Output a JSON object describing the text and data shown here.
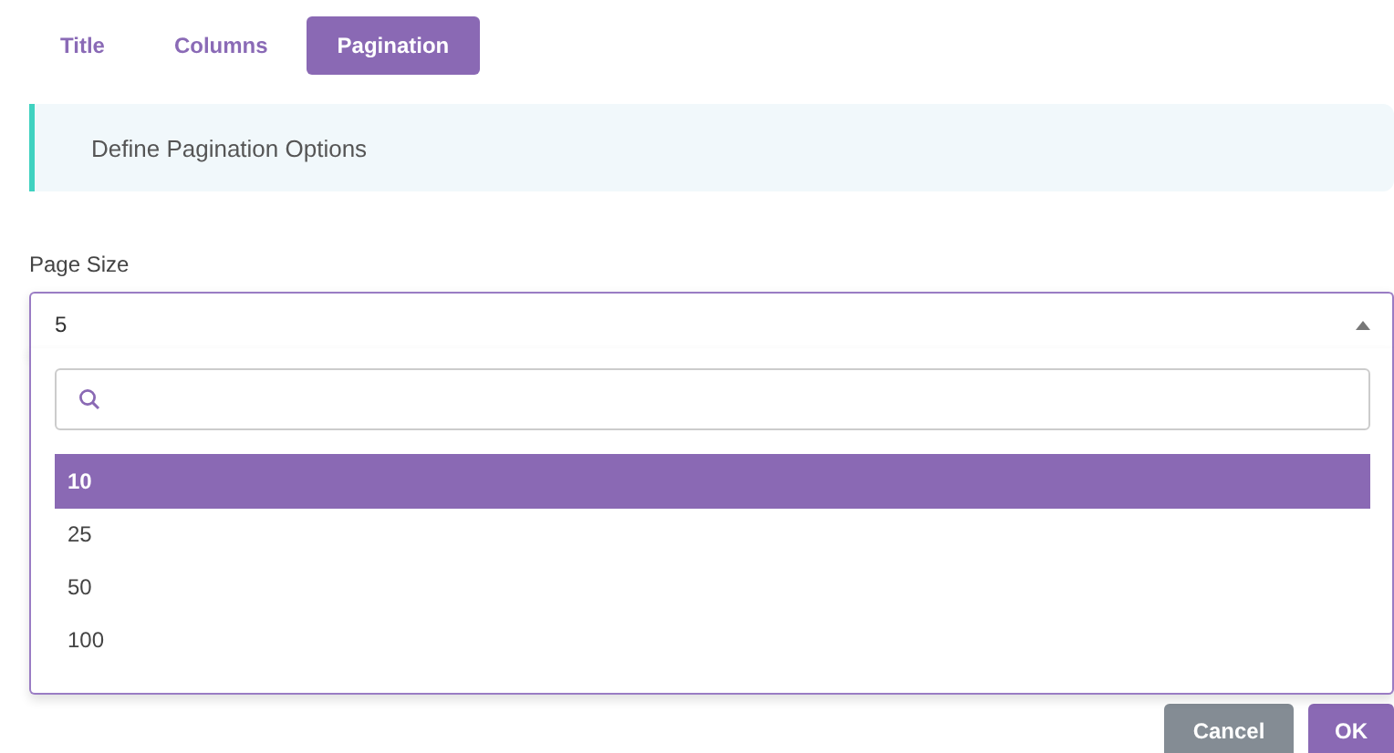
{
  "tabs": [
    {
      "label": "Title",
      "selected": false
    },
    {
      "label": "Columns",
      "selected": false
    },
    {
      "label": "Pagination",
      "selected": true
    }
  ],
  "info": "Define Pagination Options",
  "page_size": {
    "label": "Page Size",
    "value": "5",
    "expanded": true,
    "options": [
      {
        "label": "10",
        "selected": true
      },
      {
        "label": "25",
        "selected": false
      },
      {
        "label": "50",
        "selected": false
      },
      {
        "label": "100",
        "selected": false
      }
    ]
  },
  "buttons": [
    {
      "label": "Cancel",
      "kind": "secondary"
    },
    {
      "label": "OK",
      "kind": "primary"
    }
  ]
}
